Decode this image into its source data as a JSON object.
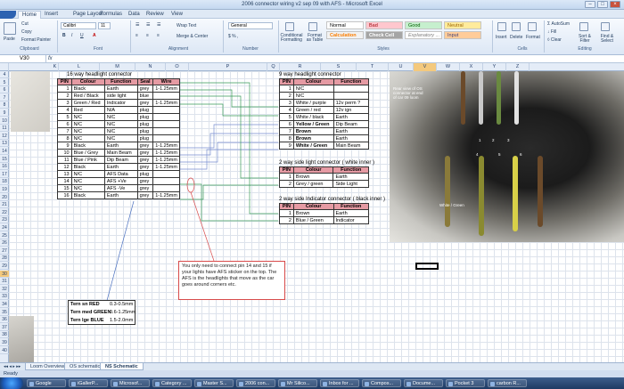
{
  "window": {
    "title": "2006 connector wiring v2 sep 09 with AFS - Microsoft Excel"
  },
  "ribbon": {
    "tabs": [
      "Home",
      "Insert",
      "Page Layout",
      "Formulas",
      "Data",
      "Review",
      "View"
    ],
    "clipboard": {
      "paste": "Paste",
      "cut": "Cut",
      "copy": "Copy",
      "format_painter": "Format Painter",
      "group": "Clipboard"
    },
    "font": {
      "name": "Calibri",
      "size": "11",
      "group": "Font"
    },
    "alignment": {
      "wrap": "Wrap Text",
      "merge": "Merge & Center",
      "group": "Alignment"
    },
    "number": {
      "format": "General",
      "group": "Number"
    },
    "styles": {
      "conditional": "Conditional Formatting",
      "format_table": "Format as Table",
      "cell_styles": "Cell Styles",
      "normal": "Normal",
      "bad": "Bad",
      "good": "Good",
      "neutral": "Neutral",
      "calculation": "Calculation",
      "check_cell": "Check Cell",
      "explanatory": "Explanatory ...",
      "input": "Input",
      "group": "Styles"
    },
    "cells": {
      "insert": "Insert",
      "delete": "Delete",
      "format": "Format",
      "group": "Cells"
    },
    "editing": {
      "autosum": "AutoSum",
      "fill": "Fill",
      "clear": "Clear",
      "sort": "Sort & Filter",
      "find": "Find & Select",
      "group": "Editing"
    }
  },
  "formula_bar": {
    "namebox": "V30",
    "fx": "fx"
  },
  "columns": [
    "K",
    "L",
    "M",
    "N",
    "O",
    "P",
    "Q",
    "R",
    "S",
    "T",
    "U",
    "V",
    "W",
    "X",
    "Y",
    "Z"
  ],
  "selected_column": "V",
  "rows": [
    "4",
    "5",
    "6",
    "7",
    "8",
    "9",
    "10",
    "11",
    "12",
    "13",
    "14",
    "15",
    "16",
    "17",
    "18",
    "19",
    "20",
    "21",
    "22",
    "23",
    "24",
    "25",
    "26",
    "27",
    "28",
    "29",
    "30",
    "31",
    "32",
    "33",
    "34",
    "35",
    "36",
    "37",
    "38",
    "39",
    "40"
  ],
  "selected_row": "30",
  "connector16": {
    "title": "16 way headlight connector",
    "headers": [
      "PIN",
      "Colour",
      "Function",
      "Seal",
      "Wire"
    ],
    "rows": [
      [
        "1",
        "Black",
        "Earth",
        "grey",
        "1-1.25mm"
      ],
      [
        "2",
        "Red / Black",
        "side light",
        "blue",
        ""
      ],
      [
        "3",
        "Green / Red",
        "Indicator",
        "grey",
        "1-1.25mm"
      ],
      [
        "4",
        "Red",
        "N/A",
        "plug",
        ""
      ],
      [
        "5",
        "N/C",
        "N/C",
        "plug",
        ""
      ],
      [
        "6",
        "N/C",
        "N/C",
        "plug",
        ""
      ],
      [
        "7",
        "N/C",
        "N/C",
        "plug",
        ""
      ],
      [
        "8",
        "N/C",
        "N/C",
        "plug",
        ""
      ],
      [
        "9",
        "Black",
        "Earth",
        "grey",
        "1-1.25mm"
      ],
      [
        "10",
        "Blue / Grey",
        "Main Beam",
        "grey",
        "1-1.25mm"
      ],
      [
        "11",
        "Blue / Pink",
        "Dip Beam",
        "grey",
        "1-1.25mm"
      ],
      [
        "12",
        "Black",
        "Earth",
        "grey",
        "1-1.25mm"
      ],
      [
        "13",
        "N/C",
        "AFS Data",
        "plug",
        ""
      ],
      [
        "14",
        "N/C",
        "AFS +Ve",
        "grey",
        ""
      ],
      [
        "15",
        "N/C",
        "AFS -Ve",
        "grey",
        ""
      ],
      [
        "16",
        "Black",
        "Earth",
        "grey",
        "1-1.25mm"
      ]
    ]
  },
  "connector9": {
    "title": "9 way headlight connector",
    "headers": [
      "PIN",
      "Colour",
      "Function"
    ],
    "rows": [
      [
        "1",
        "N/C",
        ""
      ],
      [
        "2",
        "N/C",
        ""
      ],
      [
        "3",
        "White / purple",
        "12v perm ?"
      ],
      [
        "4",
        "Green / red",
        "12v ign"
      ],
      [
        "5",
        "White / black",
        "Earth"
      ],
      [
        "6",
        "Yellow / Green",
        "Dip Beam"
      ],
      [
        "7",
        "Brown",
        "Earth"
      ],
      [
        "8",
        "Brown",
        "Earth"
      ],
      [
        "9",
        "White / Green",
        "Main Beam"
      ]
    ],
    "bold_rows": [
      "6",
      "7",
      "8",
      "9"
    ]
  },
  "connector_side": {
    "title": "2 way side light connector ( white inner )",
    "headers": [
      "PIN",
      "Colour",
      "Function"
    ],
    "rows": [
      [
        "1",
        "Brown",
        "Earth"
      ],
      [
        "2",
        "Grey / green",
        "Side Light"
      ]
    ]
  },
  "connector_ind": {
    "title": "2 way side Indicator connector ( black inner )",
    "headers": [
      "PIN",
      "Colour",
      "Function"
    ],
    "rows": [
      [
        "1",
        "Brown",
        "Earth"
      ],
      [
        "2",
        "Blue / Green",
        "Indicator"
      ]
    ]
  },
  "photo": {
    "caption": "Rear view of OS connector at end of car 09 loom",
    "label": "White / Green",
    "pins": [
      "1",
      "2",
      "3",
      "4",
      "5",
      "6"
    ]
  },
  "note": {
    "text": "You only need to connect pin 14 and 15 if your lights have AFS sticker on the top. The AFS is the headlights that move as the car goes around corners etc."
  },
  "sizes": [
    [
      "Tern sn RED",
      "0.3-0.5mm"
    ],
    [
      "Tern med GREEN",
      "0.6-1.25mm"
    ],
    [
      "Tern lge BLUE",
      "1.5-2.0mm"
    ]
  ],
  "sheet_tabs": [
    "Loom Overview",
    "OS schematic",
    "NS Schematic"
  ],
  "active_sheet": "NS Schematic",
  "status": "Ready",
  "taskbar": {
    "items": [
      "Google",
      "iGallerP...",
      "Microsof...",
      "Category ...",
      "Master S...",
      "2006 con...",
      "Mr Silico...",
      "Inbox for ...",
      "Compos...",
      "Docume...",
      "Pocket 3",
      "carbon R..."
    ]
  },
  "colors": {
    "header_pink": "#e59aa3",
    "selection": "#f4c97d",
    "note_border": "#d84a4a"
  }
}
